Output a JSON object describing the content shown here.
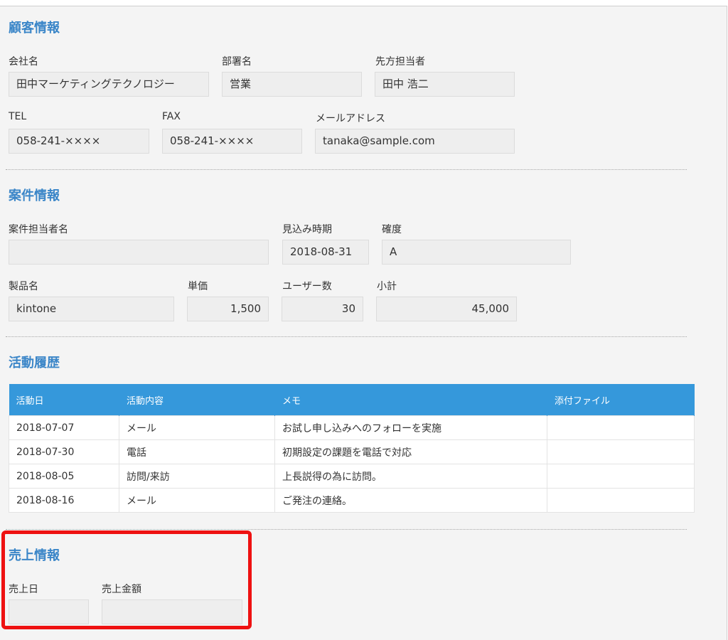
{
  "customer": {
    "title": "顧客情報",
    "company_label": "会社名",
    "company_value": "田中マーケティングテクノロジー",
    "dept_label": "部署名",
    "dept_value": "営業",
    "contact_label": "先方担当者",
    "contact_value": "田中 浩二",
    "tel_label": "TEL",
    "tel_value": "058-241-××××",
    "fax_label": "FAX",
    "fax_value": "058-241-××××",
    "email_label": "メールアドレス",
    "email_value": "tanaka@sample.com"
  },
  "deal": {
    "title": "案件情報",
    "owner_label": "案件担当者名",
    "owner_value": "",
    "expected_label": "見込み時期",
    "expected_value": "2018-08-31",
    "certainty_label": "確度",
    "certainty_value": "A",
    "product_label": "製品名",
    "product_value": "kintone",
    "unit_price_label": "単価",
    "unit_price_value": "1,500",
    "users_label": "ユーザー数",
    "users_value": "30",
    "subtotal_label": "小計",
    "subtotal_value": "45,000"
  },
  "activity": {
    "title": "活動履歴",
    "columns": [
      "活動日",
      "活動内容",
      "メモ",
      "添付ファイル"
    ],
    "rows": [
      [
        "2018-07-07",
        "メール",
        "お試し申し込みへのフォローを実施",
        ""
      ],
      [
        "2018-07-30",
        "電話",
        "初期設定の課題を電話で対応",
        ""
      ],
      [
        "2018-08-05",
        "訪問/来訪",
        "上長説得の為に訪問。",
        ""
      ],
      [
        "2018-08-16",
        "メール",
        "ご発注の連絡。",
        ""
      ]
    ]
  },
  "sales": {
    "title": "売上情報",
    "date_label": "売上日",
    "date_value": "",
    "amount_label": "売上金額",
    "amount_value": ""
  },
  "colors": {
    "section_title": "#3b86c8",
    "table_header": "#3598db",
    "highlight": "#ee1111"
  }
}
